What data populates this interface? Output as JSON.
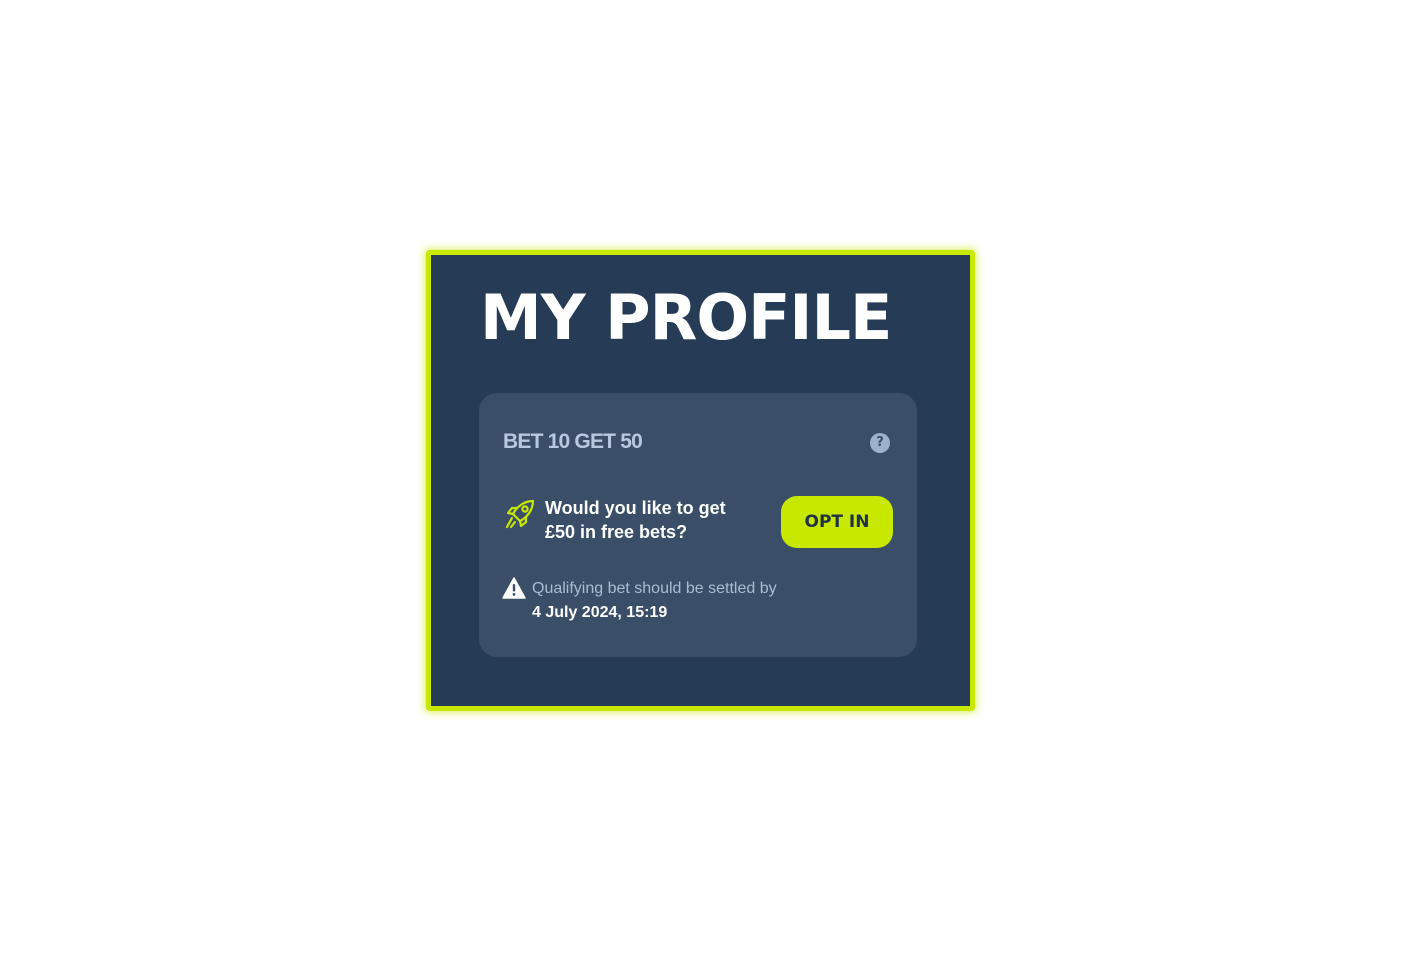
{
  "page": {
    "title": "MY PROFILE"
  },
  "promo": {
    "name": "BET 10 GET 50",
    "help_icon": "question-circle-icon",
    "help_glyph": "?",
    "offer_icon": "rocket-icon",
    "offer_line1": "Would you like to get",
    "offer_line2": "£50 in free bets?",
    "opt_in_label": "OPT IN",
    "warning_icon": "warning-triangle-icon",
    "notice_text": "Qualifying bet should be settled by",
    "deadline": "4 July 2024, 15:19"
  },
  "colors": {
    "accent": "#c8e800",
    "panel_bg": "#253b56",
    "card_bg": "#3a4f67",
    "muted_text": "#b6c9de",
    "title_text": "#ffffff"
  }
}
